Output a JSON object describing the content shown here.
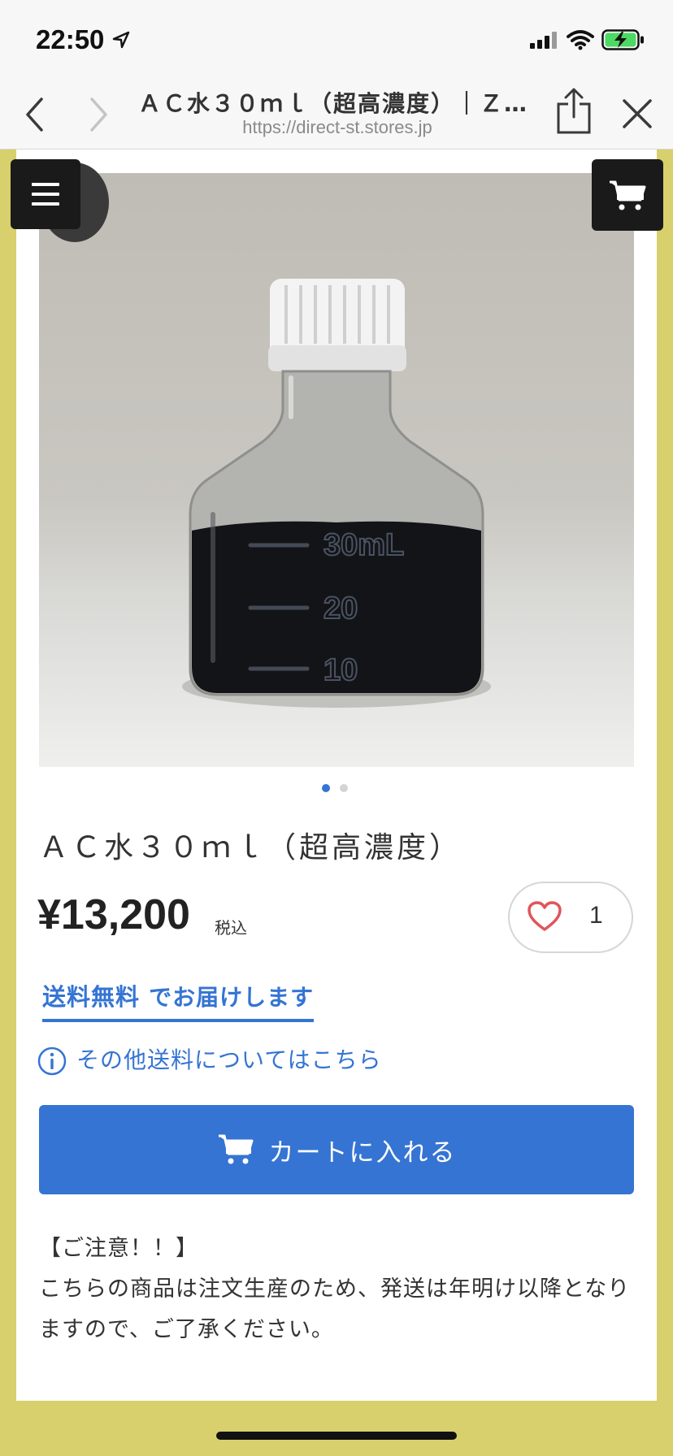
{
  "status_bar": {
    "time": "22:50"
  },
  "browser": {
    "page_title": "ＡＣ水３０ｍｌ（超高濃度）｜ＺＥＮ…",
    "url": "https://direct-st.stores.jp"
  },
  "product": {
    "name": "ＡＣ水３０ｍｌ（超高濃度）",
    "price": "¥13,200",
    "tax_label": "税込",
    "favorite_count": "1",
    "image_count": 2,
    "active_image_index": 0,
    "bottle_graduations": [
      "30mL",
      "20",
      "10"
    ]
  },
  "shipping": {
    "free_label": "送料無料",
    "free_suffix": "でお届けします",
    "other_link": "その他送料についてはこちら"
  },
  "add_to_cart_label": "カートに入れる",
  "notice": {
    "heading": "【ご注意！！】",
    "body": "こちらの商品は注文生産のため、発送は年明け以降となりますので、ご了承ください。"
  },
  "colors": {
    "accent": "#3574d3",
    "page_background": "#d8d06c",
    "button_dark": "#1a1a1a"
  }
}
